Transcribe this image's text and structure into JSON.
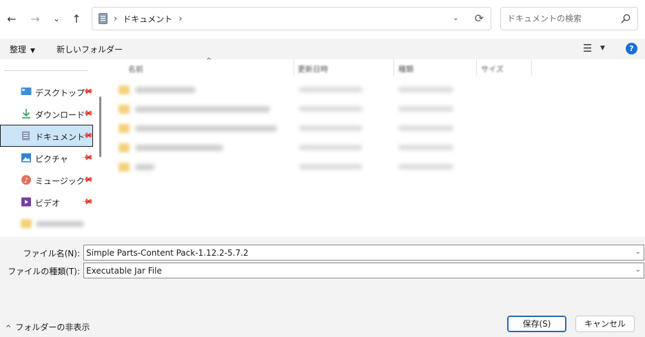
{
  "address_bar": {
    "crumb": "ドキュメント",
    "separator": "›"
  },
  "search": {
    "placeholder": "ドキュメントの検索"
  },
  "toolbar": {
    "organize_label": "整理",
    "new_folder_label": "新しいフォルダー"
  },
  "nav_pane": {
    "items": [
      {
        "label": "デスクトップ",
        "icon": "desktop-icon"
      },
      {
        "label": "ダウンロード",
        "icon": "download-icon"
      },
      {
        "label": "ドキュメント",
        "icon": "document-icon",
        "selected": true
      },
      {
        "label": "ピクチャ",
        "icon": "picture-icon"
      },
      {
        "label": "ミュージック",
        "icon": "music-icon"
      },
      {
        "label": "ビデオ",
        "icon": "video-icon"
      }
    ]
  },
  "file_list": {
    "columns": [
      "名前",
      "更新日時",
      "種類",
      "サイズ"
    ]
  },
  "form": {
    "filename_label": "ファイル名(N):",
    "filename_value": "Simple Parts-Content Pack-1.12.2-5.7.2",
    "filetype_label": "ファイルの種類(T):",
    "filetype_value": "Executable Jar File"
  },
  "footer": {
    "hide_folders_label": "フォルダーの非表示",
    "save_label": "保存(S)",
    "cancel_label": "キャンセル"
  },
  "colors": {
    "accent": "#1a6fd3",
    "selection": "#cce4f7",
    "panel": "#f3f3f3"
  }
}
